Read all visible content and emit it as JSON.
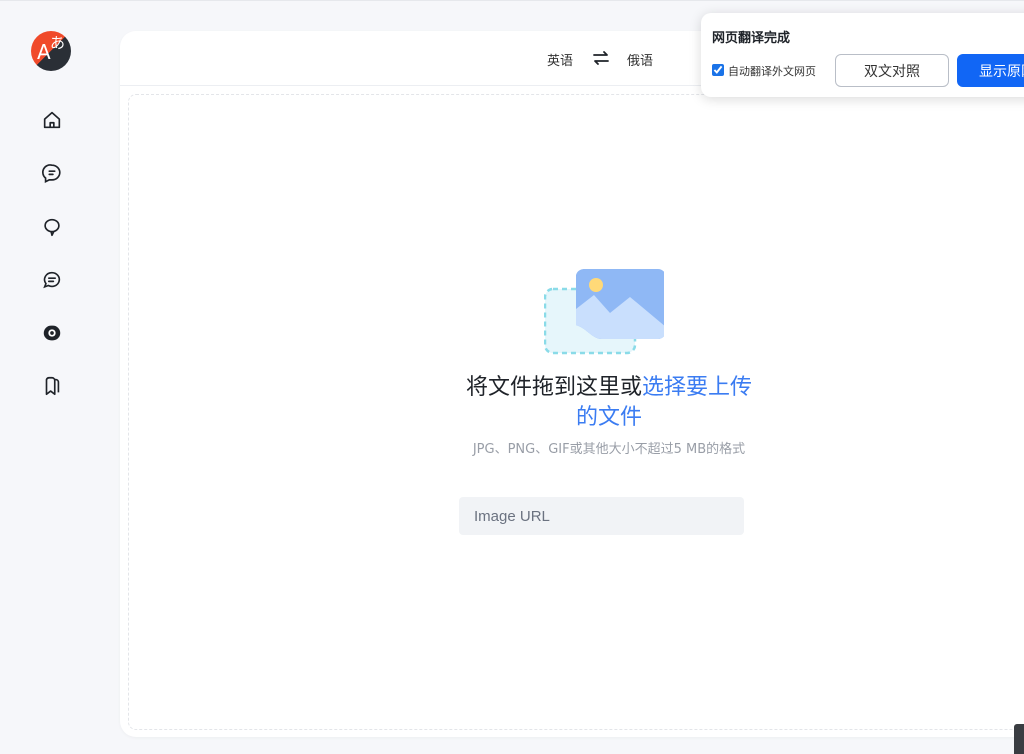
{
  "app": {
    "logo_glyph_latin": "A",
    "logo_glyph_cjk": "あ"
  },
  "sidebar": {
    "items": [
      {
        "icon": "home-icon"
      },
      {
        "icon": "chat-translate-icon"
      },
      {
        "icon": "chat-bubble-icon"
      },
      {
        "icon": "text-message-icon"
      },
      {
        "icon": "image-translate-icon",
        "active": true
      },
      {
        "icon": "bookmark-icon"
      }
    ]
  },
  "language_bar": {
    "source": "英语",
    "target": "俄语"
  },
  "upload": {
    "title_plain": "将文件拖到这里或",
    "title_link": "选择要上传的文件",
    "hint": "JPG、PNG、GIF或其他大小不超过5 MB的格式",
    "url_placeholder": "Image URL"
  },
  "translate_popup": {
    "title": "网页翻译完成",
    "auto_translate_label": "自动翻译外文网页",
    "auto_translate_checked": true,
    "bilingual_button": "双文对照",
    "show_original_button": "显示原网页"
  },
  "colors": {
    "accent": "#3b7cf2",
    "primary_button": "#1166f5",
    "logo_red": "#f04a2a",
    "logo_dark": "#2a2f36"
  }
}
